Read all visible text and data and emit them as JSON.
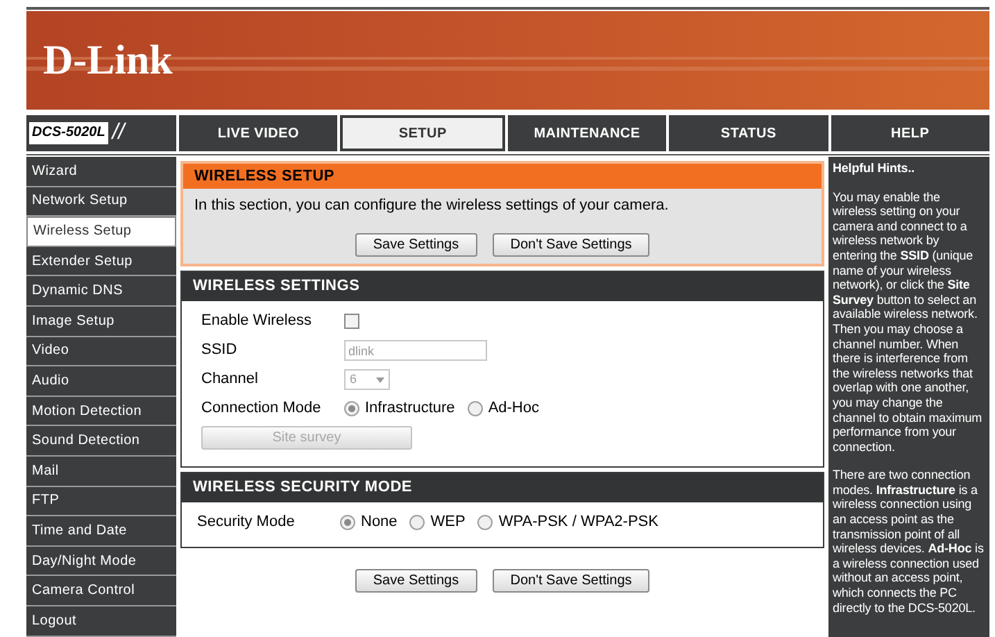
{
  "header": {
    "logo": "D-Link",
    "model": "DCS-5020L",
    "model_mark": "//"
  },
  "nav": [
    {
      "label": "LIVE VIDEO",
      "selected": false
    },
    {
      "label": "SETUP",
      "selected": true
    },
    {
      "label": "MAINTENANCE",
      "selected": false
    },
    {
      "label": "STATUS",
      "selected": false
    },
    {
      "label": "HELP",
      "selected": false
    }
  ],
  "sidebar": [
    {
      "label": "Wizard",
      "selected": false
    },
    {
      "label": "Network Setup",
      "selected": false
    },
    {
      "label": "Wireless Setup",
      "selected": true
    },
    {
      "label": "Extender Setup",
      "selected": false
    },
    {
      "label": "Dynamic DNS",
      "selected": false
    },
    {
      "label": "Image Setup",
      "selected": false
    },
    {
      "label": "Video",
      "selected": false
    },
    {
      "label": "Audio",
      "selected": false
    },
    {
      "label": "Motion Detection",
      "selected": false
    },
    {
      "label": "Sound Detection",
      "selected": false
    },
    {
      "label": "Mail",
      "selected": false
    },
    {
      "label": "FTP",
      "selected": false
    },
    {
      "label": "Time and Date",
      "selected": false
    },
    {
      "label": "Day/Night Mode",
      "selected": false
    },
    {
      "label": "Camera Control",
      "selected": false
    },
    {
      "label": "Logout",
      "selected": false
    }
  ],
  "wireless_setup": {
    "title": "WIRELESS SETUP",
    "description": "In this section, you can configure the wireless settings of your camera.",
    "buttons": [
      "Save Settings",
      "Don't Save Settings"
    ]
  },
  "wireless_settings": {
    "title": "WIRELESS SETTINGS",
    "fields": [
      {
        "kind": "checkbox",
        "label": "Enable Wireless",
        "checked": false
      },
      {
        "kind": "text",
        "label": "SSID",
        "value": "dlink",
        "disabled": true
      },
      {
        "kind": "select",
        "label": "Channel",
        "value": "6",
        "disabled": true
      },
      {
        "kind": "radio",
        "label": "Connection Mode",
        "options": [
          {
            "label": "Infrastructure",
            "selected": true
          },
          {
            "label": "Ad-Hoc",
            "selected": false
          }
        ]
      },
      {
        "kind": "button",
        "label": "Site survey",
        "disabled": true
      }
    ]
  },
  "security": {
    "title": "WIRELESS SECURITY MODE",
    "fields": [
      {
        "kind": "radio",
        "label": "Security Mode",
        "options": [
          {
            "label": "None",
            "selected": true
          },
          {
            "label": "WEP",
            "selected": false
          },
          {
            "label": "WPA-PSK / WPA2-PSK",
            "selected": false
          }
        ]
      }
    ]
  },
  "bottom_buttons": [
    "Save Settings",
    "Don't Save Settings"
  ],
  "help": {
    "title": "Helpful Hints..",
    "paragraphs": [
      "You may enable the wireless setting on your camera and connect to a wireless network by entering the **SSID** (unique name of your wireless network), or click the **Site Survey** button to select an available wireless network. Then you may choose a channel number. When there is interference from the wireless networks that overlap with one another, you may change the channel to obtain maximum performance from your connection.",
      "There are two connection modes. **Infrastructure** is a wireless connection using an access point as the transmission point of all wireless devices. **Ad-Hoc** is a wireless connection used without an access point, which connects the PC directly to the DCS-5020L."
    ]
  }
}
